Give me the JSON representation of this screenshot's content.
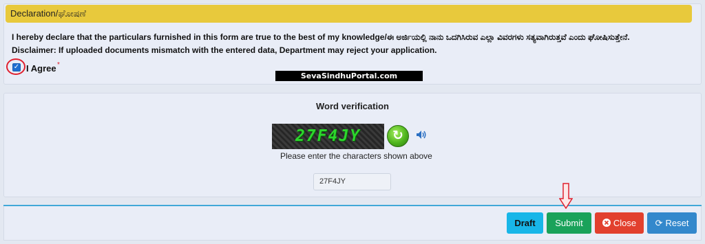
{
  "declaration": {
    "header": "Declaration/ಘೋಷಣೆ",
    "text": "I hereby declare that the particulars furnished in this form are true to the best of my knowledge/ಈ ಅರ್ಜಿಯಲ್ಲಿ ನಾನು ಒದಗಿಸಿರುವ ಎಲ್ಲಾ ವಿವರಗಳು ಸತ್ಯವಾಗಿರುತ್ತವೆ ಎಂದು ಘೋಷಿಸುತ್ತೇನೆ.",
    "disclaimer": "Disclaimer: If uploaded documents mismatch with the entered data, Department may reject your application.",
    "agree_label": "I Agree",
    "agree_checked": true,
    "required_marker": "*"
  },
  "watermark": "SevaSindhuPortal.com",
  "verification": {
    "title": "Word verification",
    "captcha_text": "27F4JY",
    "hint": "Please enter the characters shown above",
    "input_value": "27F4JY",
    "refresh_icon": "refresh-icon",
    "audio_icon": "speaker-icon"
  },
  "buttons": {
    "draft": "Draft",
    "submit": "Submit",
    "close": "Close",
    "reset": "Reset"
  },
  "colors": {
    "header_bg": "#e8c93c",
    "draft": "#18b6e8",
    "submit": "#1aa25a",
    "close": "#e2402e",
    "reset": "#3388cc",
    "annotation_red": "#e0202e"
  }
}
